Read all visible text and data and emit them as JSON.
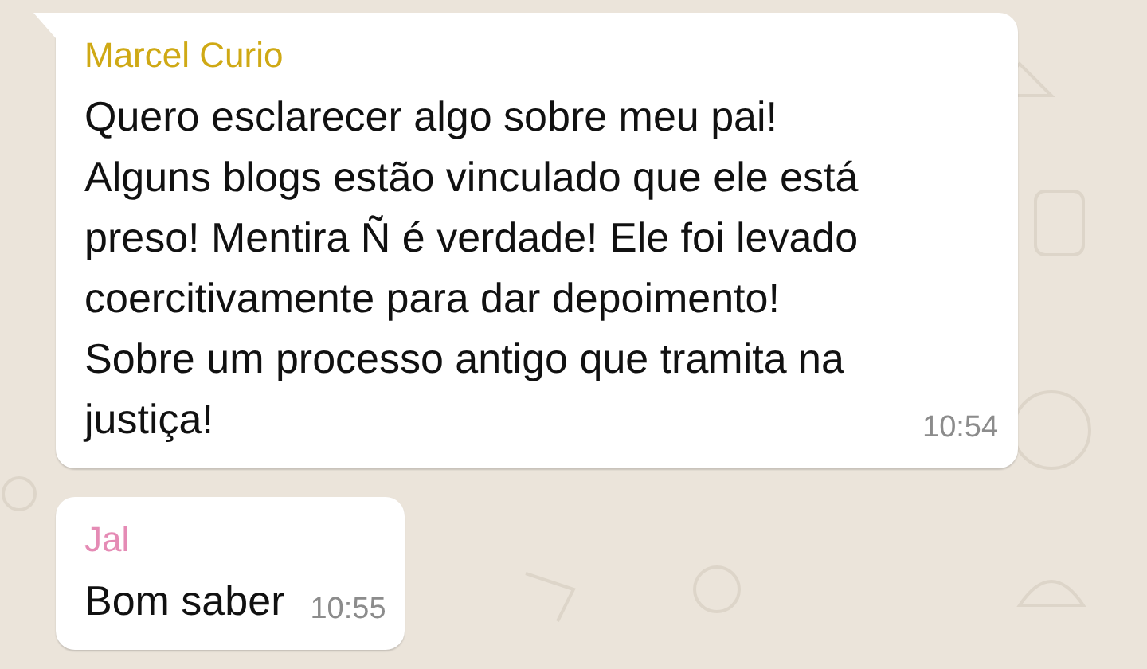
{
  "messages": [
    {
      "sender": "Marcel Curio",
      "color": "#cfa915",
      "text": "Quero esclarecer algo sobre meu pai! Alguns blogs estão vinculado que ele está preso! Mentira Ñ é verdade! Ele foi levado coercitivamente para dar depoimento! Sobre um processo antigo que tramita na justiça!",
      "time": "10:54",
      "tail": true
    },
    {
      "sender": "Jal",
      "color": "#e58bb5",
      "text": "Bom saber",
      "time": "10:55",
      "tail": false
    }
  ]
}
